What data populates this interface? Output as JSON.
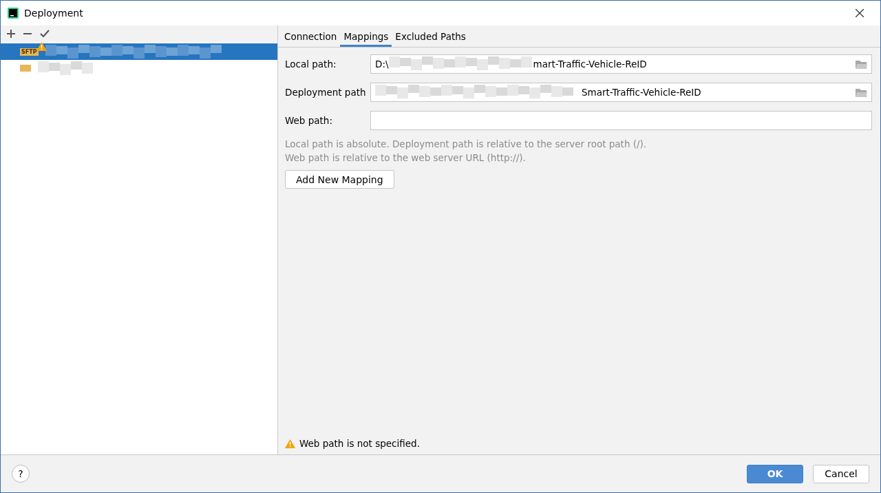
{
  "window": {
    "title": "Deployment"
  },
  "toolbar": [
    {
      "kind": "add"
    },
    {
      "kind": "remove"
    },
    {
      "kind": "check"
    }
  ],
  "servers": [
    {
      "badge": "SFTP",
      "selected": true,
      "warning": true
    },
    {
      "selected": false,
      "warning": false
    }
  ],
  "tabs": [
    {
      "label": "Connection",
      "selected": false
    },
    {
      "label": "Mappings",
      "selected": true
    },
    {
      "label": "Excluded Paths",
      "selected": false
    }
  ],
  "fields": [
    {
      "label": "Local path:",
      "prefix": "D:\\",
      "suffix": "mart-Traffic-Vehicle-ReID",
      "redacted": true,
      "browse": true
    },
    {
      "label": "Deployment path",
      "suffix": "Smart-Traffic-Vehicle-ReID",
      "redacted": true,
      "browse": true
    },
    {
      "label": "Web path:",
      "redacted": false,
      "browse": false
    }
  ],
  "hint": [
    "Local path is absolute. Deployment path is relative to the server root path (/).",
    "Web path is relative to the web server URL (http://)."
  ],
  "add_button": "Add New Mapping",
  "warning": "Web path is not specified.",
  "help": "?",
  "buttons": [
    {
      "label": "OK",
      "kind": "primary"
    },
    {
      "label": "Cancel",
      "kind": "secondary"
    }
  ]
}
